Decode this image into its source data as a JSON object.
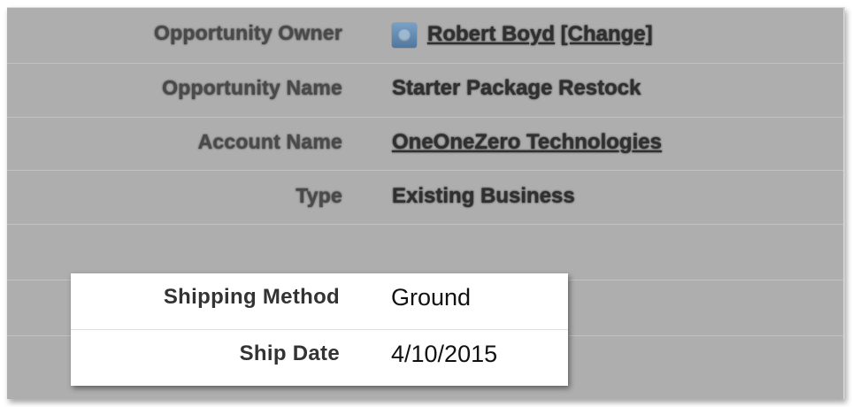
{
  "detail": {
    "owner_label": "Opportunity Owner",
    "owner_name": "Robert Boyd",
    "owner_change": "[Change]",
    "name_label": "Opportunity Name",
    "name_value": "Starter Package Restock",
    "account_label": "Account Name",
    "account_value": "OneOneZero Technologies",
    "type_label": "Type",
    "type_value": "Existing Business"
  },
  "highlight": {
    "shipping_label": "Shipping Method",
    "shipping_value": "Ground",
    "ship_date_label": "Ship Date",
    "ship_date_value": "4/10/2015"
  },
  "colors": {
    "dimmed_background": "#aeaeae",
    "highlight_background": "#ffffff",
    "avatar": "#5b82aa"
  },
  "icons": {
    "owner_avatar": "user-avatar-icon"
  }
}
